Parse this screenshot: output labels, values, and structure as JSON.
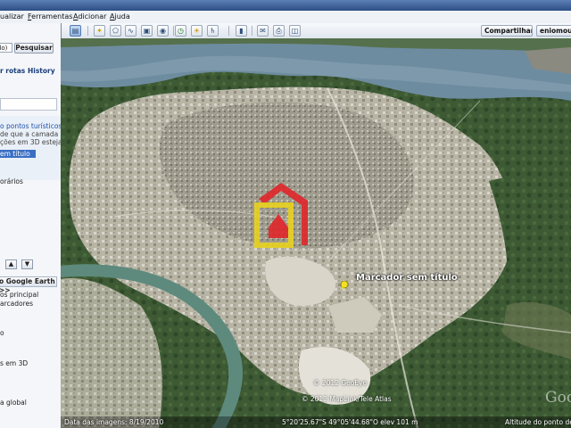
{
  "menu": {
    "items": [
      {
        "label": "ualizar"
      },
      {
        "label": "Ferramentas",
        "accel": "F"
      },
      {
        "label": "Adicionar",
        "accel": "A"
      },
      {
        "label": "Ajuda",
        "accel": "A"
      }
    ]
  },
  "toolbar": {
    "share_label": "Compartilhar",
    "user_label": "eniomour"
  },
  "sidebar": {
    "search_value": "ulo)",
    "search_button": "Pesquisar",
    "tab_routes": "r rotas",
    "tab_history": "History",
    "places_lines": [
      "o pontos turísticos",
      "de que a camada",
      "ções em 3D esteja",
      "em título",
      "orários"
    ],
    "layers_header": "o Google Earth",
    "layers_header_arrows": ">>",
    "layers_lines": [
      "os principal",
      "arcadores",
      "o",
      "s em 3D",
      "a global"
    ]
  },
  "map": {
    "marker_label": "Marcador sem título",
    "copyright_1": "© 2012 GeoEye",
    "copyright_2": "© 2012 MapLink/Tele Atlas",
    "image_date": "Data das imagens: 8/19/2010",
    "coordinates": "5°20'25.67\"S 49°05'44.68\"O elev 101 m",
    "altitude": "Altitude do ponto de",
    "logo_text": "Goo"
  },
  "colors": {
    "river": "#6f8da0",
    "vegetation": "#3e5a34",
    "urban": "#b9b6a6",
    "logo_house_red": "#e0262a",
    "logo_house_yellow": "#e8d21e"
  }
}
